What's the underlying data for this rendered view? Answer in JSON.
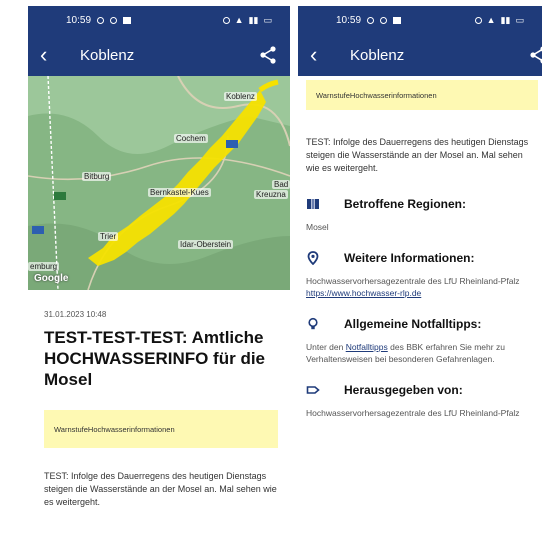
{
  "status": {
    "time": "10:59"
  },
  "appbar": {
    "title": "Koblenz"
  },
  "map": {
    "labels": {
      "koblenz": "Koblenz",
      "cochem": "Cochem",
      "bitburg": "Bitburg",
      "bernkastel": "Bernkastel-Kues",
      "trier": "Trier",
      "idar": "Idar-Oberstein",
      "luxemburg": "emburg",
      "bad": "Bad",
      "kreuzna": "Kreuzna"
    },
    "logo": "Google",
    "warn_color": "#f6e100"
  },
  "report": {
    "date": "31.01.2023 10:48",
    "headline": "TEST-TEST-TEST: Amtliche HOCHWASSERINFO für die Mosel",
    "warn_prefix": "Warnstufe",
    "warn_level": "Hochwasserinformationen",
    "text": "TEST: Infolge des Dauerregens des heutigen Dienstags steigen die Wasserstände an der Mosel an. Mal sehen wie es weitergeht."
  },
  "sections": {
    "regions": {
      "title": "Betroffene Regionen:",
      "body": "Mosel"
    },
    "info": {
      "title": "Weitere Informationen:",
      "body": "Hochwasservorhersagezentrale des LfU Rheinland-Pfalz",
      "link": "https://www.hochwasser-rlp.de"
    },
    "tips": {
      "title": "Allgemeine Notfalltipps:",
      "pre": "Unter den ",
      "link": "Notfalltipps",
      "post": " des BBK erfahren Sie mehr zu Verhaltensweisen bei besonderen Gefahrenlagen."
    },
    "publisher": {
      "title": "Herausgegeben von:",
      "body": "Hochwasservorhersagezentrale des LfU Rheinland-Pfalz"
    }
  },
  "colors": {
    "primary": "#1f3b7a",
    "warn_bg": "#fef9b3"
  }
}
